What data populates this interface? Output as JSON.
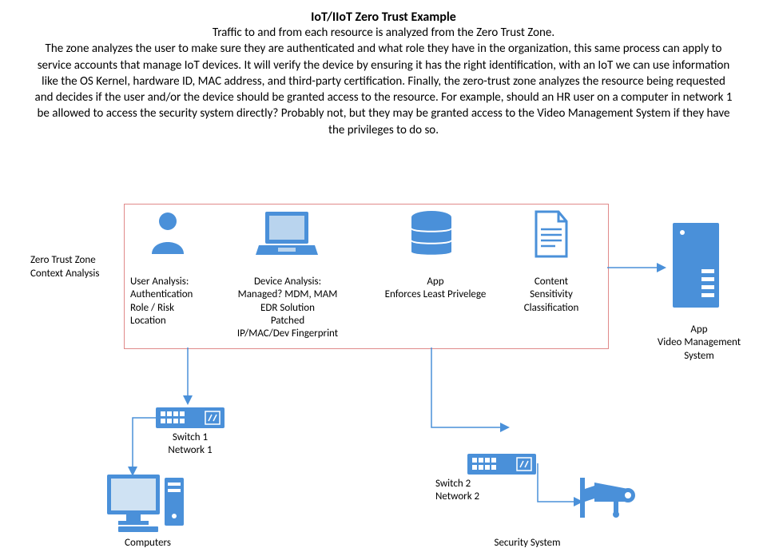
{
  "title": "IoT/IIoT Zero Trust Example",
  "description": "Traffic to and from each resource is analyzed from the Zero Trust Zone.\nThe zone analyzes the user to make sure they are authenticated and what role they have in the organization, this same process can apply to service accounts that manage IoT devices. It will verify the device by ensuring it has the right identification, with an IoT we can use information like the OS Kernel, hardware ID, MAC address, and third-party certification. Finally, the zero-trust zone analyzes the resource being requested and decides if the user and/or the device should be granted access to the resource. For example, should an HR user on a computer in network 1 be allowed to access the security system directly? Probably not, but they may be granted access to the Video Management System if they have the privileges to do so.",
  "sideLabel": "Zero Trust Zone\nContext Analysis",
  "nodes": {
    "user": {
      "label": "User Analysis:\nAuthentication\nRole / Risk\nLocation"
    },
    "device": {
      "label": "Device Analysis:\nManaged? MDM, MAM\nEDR Solution\nPatched\nIP/MAC/Dev Fingerprint"
    },
    "app": {
      "label": "App\nEnforces Least Privelege"
    },
    "content": {
      "label": "Content\nSensitivity\nClassification"
    },
    "server": {
      "label": "App\nVideo Management\nSystem"
    },
    "switch1": {
      "label": "Switch 1\nNetwork 1"
    },
    "switch2": {
      "label": "Switch 2\nNetwork 2"
    },
    "computers": {
      "label": "Computers"
    },
    "security": {
      "label": "Security System"
    }
  }
}
